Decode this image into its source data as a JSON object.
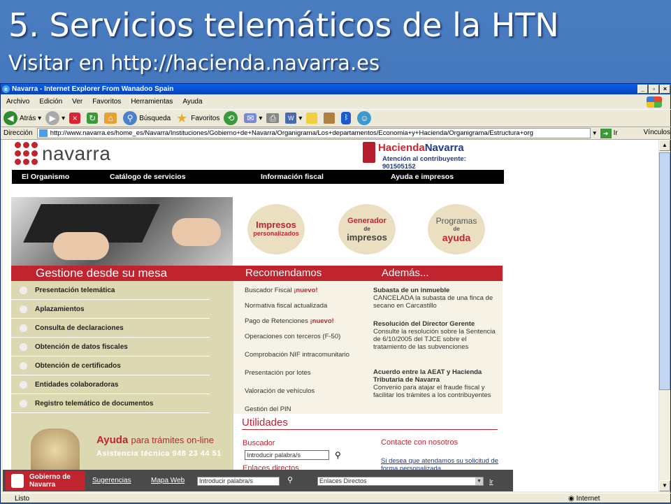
{
  "slide": {
    "title": "5. Servicios telemáticos de la HTN",
    "subtitle": "Visitar en http://hacienda.navarra.es"
  },
  "browser": {
    "window_title": "Navarra - Internet Explorer From Wanadoo Spain",
    "menu": [
      "Archivo",
      "Edición",
      "Ver",
      "Favoritos",
      "Herramientas",
      "Ayuda"
    ],
    "toolbar": {
      "back": "Atrás",
      "search": "Búsqueda",
      "favorites": "Favoritos"
    },
    "address_label": "Dirección",
    "address_url": "http://www.navarra.es/home_es/Navarra/Instituciones/Gobierno+de+Navarra/Organigrama/Los+departamentos/Economia+y+Hacienda/Organigrama/Estructura+org",
    "go_label": "Ir",
    "links_label": "Vínculos",
    "status_text": "Listo",
    "zone_text": "Internet"
  },
  "site": {
    "logo_text": "navarra",
    "hacienda_a": "Hacienda",
    "hacienda_b": "Navarra",
    "atencion": "Atención al contribuyente: 901505152",
    "topnav": [
      "El Organismo",
      "Catálogo de servicios",
      "Información fiscal",
      "Ayuda e impresos"
    ],
    "circles": [
      {
        "l1": "Impresos",
        "l2": "personalizados"
      },
      {
        "l1": "Generador",
        "l2": "de",
        "l3": "impresos"
      },
      {
        "l1": "Programas",
        "l2": "de",
        "l3": "ayuda"
      }
    ],
    "band_left": "Gestione desde su mesa",
    "band_mid": "Recomendamos",
    "band_right": "Además...",
    "left_items": [
      "Presentación telemática",
      "Aplazamientos",
      "Consulta de declaraciones",
      "Obtención de datos fiscales",
      "Obtención de certificados",
      "Entidades colaboradoras",
      "Registro telemático de documentos"
    ],
    "mid_items": [
      {
        "text": "Buscador Fiscal ",
        "new": "¡nuevo!"
      },
      {
        "text": "Normativa fiscal actualizada",
        "new": ""
      },
      {
        "text": "Pago de Retenciones ",
        "new": "¡nuevo!"
      },
      {
        "text": "Operaciones con terceros (F-50)",
        "new": ""
      },
      {
        "text": "Comprobación NIF intracomunitario",
        "new": ""
      },
      {
        "text": "Presentación por lotes",
        "new": ""
      },
      {
        "text": "Valoración de vehículos",
        "new": ""
      },
      {
        "text": "Gestión del PIN",
        "new": ""
      }
    ],
    "news": [
      {
        "title": "Subasta de un inmueble",
        "body": "CANCELADA la subasta de una finca de secano en Carcastillo"
      },
      {
        "title": "Resolución del Director Gerente",
        "body": "Consulte la resolución sobre la Sentencia de 6/10/2005 del TJCE sobre el tratamiento de las subvenciones"
      },
      {
        "title": "Acuerdo entre la AEAT y Hacienda Tributaria de Navarra",
        "body": "Convenio para atajar el fraude fiscal y facilitar los trámites a los contribuyentes"
      }
    ],
    "utilidades": "Utilidades",
    "buscador": "Buscador",
    "buscador_placeholder": "Introducir palabra/s",
    "enlaces": "Enlaces directos",
    "contacte": "Contacte con nosotros",
    "solicitud": "Si desea que atendamos su solicitud de forma personalizada...",
    "ayuda_title": "Ayuda",
    "ayuda_sub": "para trámites on-line",
    "asistencia": "Asistencia técnica   948 23 44 51",
    "footer": {
      "gov": "Gobierno de Navarra",
      "sugerencias": "Sugerencias",
      "mapa": "Mapa Web",
      "search_placeholder": "Introducir palabra/s",
      "select_value": "Enlaces Directos",
      "ir": "Ir"
    }
  }
}
